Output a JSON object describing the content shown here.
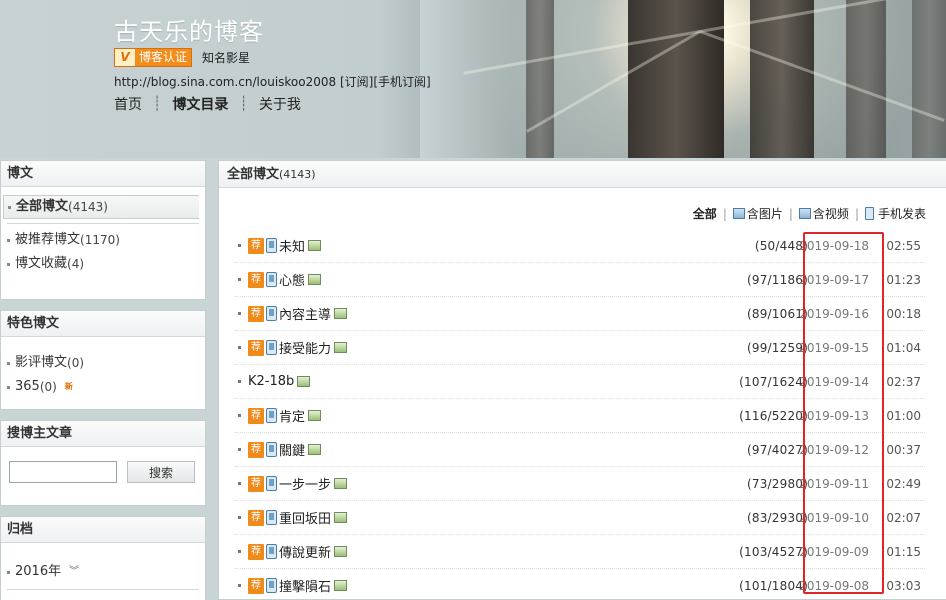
{
  "header": {
    "title": "古天乐的博客",
    "verify_badge": "博客认证",
    "verify_v": "V",
    "verify_note": "知名影星",
    "url_line": "http://blog.sina.com.cn/louiskoo2008 [订阅][手机订阅]",
    "nav": [
      "首页",
      "博文目录",
      "关于我"
    ]
  },
  "sidebar": {
    "posts_box": {
      "title": "博文",
      "current": {
        "label": "全部博文",
        "count": "(4143)"
      },
      "items": [
        {
          "label": "被推荐博文",
          "count": "(1170)"
        },
        {
          "label": "博文收藏",
          "count": "(4)"
        }
      ]
    },
    "featured_box": {
      "title": "特色博文",
      "items": [
        {
          "label": "影评博文",
          "count": "(0)"
        },
        {
          "label": "365",
          "count": "(0)"
        }
      ],
      "new_badge": "新"
    },
    "search_box": {
      "title": "搜博主文章",
      "button": "搜索",
      "value": ""
    },
    "archive_box": {
      "title": "归档",
      "item": "2016年"
    }
  },
  "main": {
    "title": "全部博文",
    "count": "(4143)",
    "filters": [
      "全部",
      "含图片",
      "含视频",
      "手机发表"
    ],
    "rec_label": "荐",
    "posts": [
      {
        "title": "未知",
        "stats": "(50/448)",
        "date": "2019-09-18",
        "time": "02:55",
        "recommended": true
      },
      {
        "title": "心態",
        "stats": "(97/1186)",
        "date": "2019-09-17",
        "time": "01:23",
        "recommended": true
      },
      {
        "title": "內容主導",
        "stats": "(89/1061)",
        "date": "2019-09-16",
        "time": "00:18",
        "recommended": true
      },
      {
        "title": "接受能力",
        "stats": "(99/1259)",
        "date": "2019-09-15",
        "time": "01:04",
        "recommended": true
      },
      {
        "title": "K2-18b",
        "stats": "(107/1624)",
        "date": "2019-09-14",
        "time": "02:37",
        "recommended": false
      },
      {
        "title": "肯定",
        "stats": "(116/5220)",
        "date": "2019-09-13",
        "time": "01:00",
        "recommended": true
      },
      {
        "title": "關鍵",
        "stats": "(97/4027)",
        "date": "2019-09-12",
        "time": "00:37",
        "recommended": true
      },
      {
        "title": "一步一步",
        "stats": "(73/2980)",
        "date": "2019-09-11",
        "time": "02:49",
        "recommended": true
      },
      {
        "title": "重回坂田",
        "stats": "(83/2930)",
        "date": "2019-09-10",
        "time": "02:07",
        "recommended": true
      },
      {
        "title": "傳說更新",
        "stats": "(103/4527)",
        "date": "2019-09-09",
        "time": "01:15",
        "recommended": true
      },
      {
        "title": "撞擊隕石",
        "stats": "(101/1804)",
        "date": "2019-09-08",
        "time": "03:03",
        "recommended": true
      }
    ]
  },
  "colors": {
    "accent": "#f08a1a",
    "highlight": "#e0242a"
  }
}
